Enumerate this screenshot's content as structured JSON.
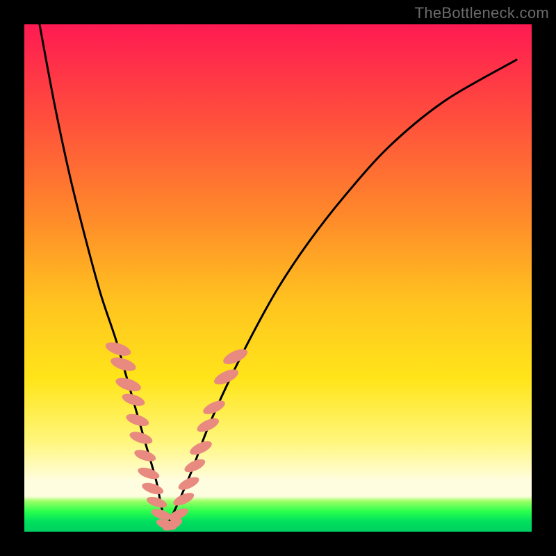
{
  "watermark": "TheBottleneck.com",
  "colors": {
    "curve_stroke": "#000000",
    "marker_fill": "#e88a7f",
    "marker_stroke": "#cf6a5f",
    "gradient_top": "#ff1a52",
    "gradient_mid_upper": "#ff8a2a",
    "gradient_mid": "#ffe51a",
    "gradient_mid_lower": "#fffde0",
    "gradient_bottom": "#00d060"
  },
  "chart_data": {
    "type": "line",
    "title": "",
    "xlabel": "",
    "ylabel": "",
    "xlim": [
      0,
      100
    ],
    "ylim": [
      0,
      100
    ],
    "grid": false,
    "legend": false,
    "notes": "Axes have no visible tick labels or numbers; x/y values are estimated relative to the plot area (0–100 each). y measures distance from the bottom (0) to top (100). Two smooth black curves descend from the top into a V near x≈28, y≈0. Salmon-colored marker blobs cluster on both arms of the V in the lower third.",
    "series": [
      {
        "name": "left-arm",
        "x": [
          3,
          6,
          9,
          12,
          15,
          18,
          20,
          22,
          24,
          26,
          27,
          28
        ],
        "y": [
          100,
          84,
          70,
          58,
          47,
          38,
          31,
          24,
          17,
          10,
          5,
          1
        ]
      },
      {
        "name": "right-arm",
        "x": [
          28,
          30,
          33,
          36,
          40,
          45,
          50,
          56,
          63,
          72,
          83,
          97
        ],
        "y": [
          1,
          5,
          12,
          20,
          29,
          39,
          48,
          57,
          66,
          76,
          85,
          93
        ]
      }
    ],
    "markers": [
      {
        "x": 18.5,
        "y": 36,
        "r": 2.0
      },
      {
        "x": 19.5,
        "y": 33,
        "r": 2.0
      },
      {
        "x": 20.5,
        "y": 29,
        "r": 2.0
      },
      {
        "x": 21.5,
        "y": 26,
        "r": 1.8
      },
      {
        "x": 22.3,
        "y": 22,
        "r": 1.8
      },
      {
        "x": 23.0,
        "y": 18.5,
        "r": 1.8
      },
      {
        "x": 23.8,
        "y": 15,
        "r": 1.7
      },
      {
        "x": 24.5,
        "y": 11.5,
        "r": 1.7
      },
      {
        "x": 25.3,
        "y": 8.5,
        "r": 1.7
      },
      {
        "x": 26.1,
        "y": 5.8,
        "r": 1.6
      },
      {
        "x": 27.0,
        "y": 3.4,
        "r": 1.6
      },
      {
        "x": 28.0,
        "y": 1.4,
        "r": 1.6
      },
      {
        "x": 29.2,
        "y": 1.4,
        "r": 1.6
      },
      {
        "x": 30.4,
        "y": 3.4,
        "r": 1.6
      },
      {
        "x": 31.4,
        "y": 6.4,
        "r": 1.7
      },
      {
        "x": 32.4,
        "y": 9.5,
        "r": 1.7
      },
      {
        "x": 33.6,
        "y": 13,
        "r": 1.7
      },
      {
        "x": 34.8,
        "y": 16.5,
        "r": 1.8
      },
      {
        "x": 36.2,
        "y": 21,
        "r": 1.8
      },
      {
        "x": 37.4,
        "y": 24.5,
        "r": 1.8
      },
      {
        "x": 39.8,
        "y": 30.5,
        "r": 2.0
      },
      {
        "x": 41.6,
        "y": 34.5,
        "r": 2.0
      }
    ]
  }
}
